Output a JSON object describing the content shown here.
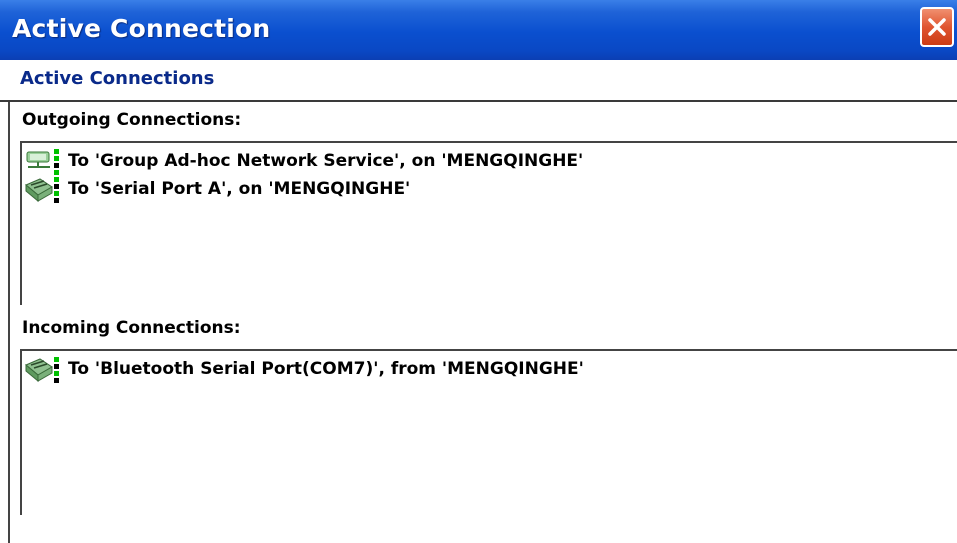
{
  "window": {
    "title": "Active Connection",
    "close_label": "close"
  },
  "header": {
    "title": "Active Connections"
  },
  "outgoing": {
    "label": "Outgoing Connections:",
    "items": [
      {
        "icon": "network-connection-icon",
        "text": "To 'Group Ad-hoc Network Service', on 'MENGQINGHE'"
      },
      {
        "icon": "serial-port-icon",
        "text": "To 'Serial Port A', on 'MENGQINGHE'"
      }
    ]
  },
  "incoming": {
    "label": "Incoming Connections:",
    "items": [
      {
        "icon": "serial-port-icon",
        "text": "To 'Bluetooth Serial Port(COM7)', from 'MENGQINGHE'"
      }
    ]
  },
  "colors": {
    "title_bar": "#0a4fcf",
    "header_text": "#0a2a8a",
    "close_button": "#e05530",
    "status_green": "#00c000"
  }
}
